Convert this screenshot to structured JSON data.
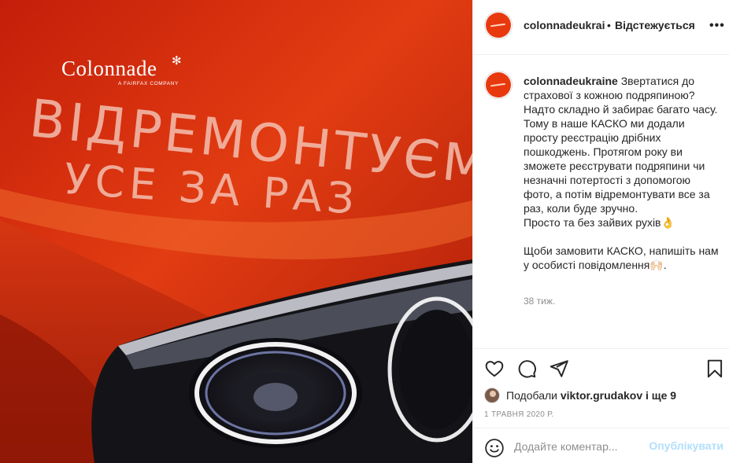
{
  "post": {
    "brand_name": "Colonnade",
    "brand_sub": "A FAIRFAX COMPANY",
    "scribble_line1": "ВІДРЕМОНТУЄМО",
    "scribble_line2": "УСЕ ЗА РАЗ"
  },
  "header": {
    "username": "colonnadeukrai",
    "dot": "•",
    "follow_label": "Відстежується",
    "more_icon": "more-horizontal-icon"
  },
  "caption": {
    "username": "colonnadeukraine",
    "lines": [
      "Звертатися до страхової з кожною подряпиною? Надто складно й забирає багато часу.",
      "Тому в наше КАСКО ми додали просту реєстрацію дрібних пошкоджень. Протягом року ви зможете реєструвати подряпини чи незначні потертості з допомогою фото, а потім відремонтувати все за раз, коли буде зручно.",
      "Просто та без зайвих рухів👌",
      "Щоби замовити КАСКО, напишіть нам у особисті повідомлення🙌🏻."
    ],
    "time": "38 тиж."
  },
  "actions": {
    "icons": [
      "heart-icon",
      "comment-icon",
      "share-icon",
      "bookmark-icon"
    ],
    "likes_prefix": "Подобали",
    "likes_user": "viktor.grudakov",
    "likes_suffix": "і ще 9",
    "date": "1 ТРАВНЯ 2020 Р."
  },
  "comment": {
    "placeholder": "Додайте коментар...",
    "publish_label": "Опублікувати"
  },
  "colors": {
    "brand_orange": "#e8390e",
    "publish_disabled": "#b2dffc",
    "muted_text": "#8e8e8e"
  }
}
